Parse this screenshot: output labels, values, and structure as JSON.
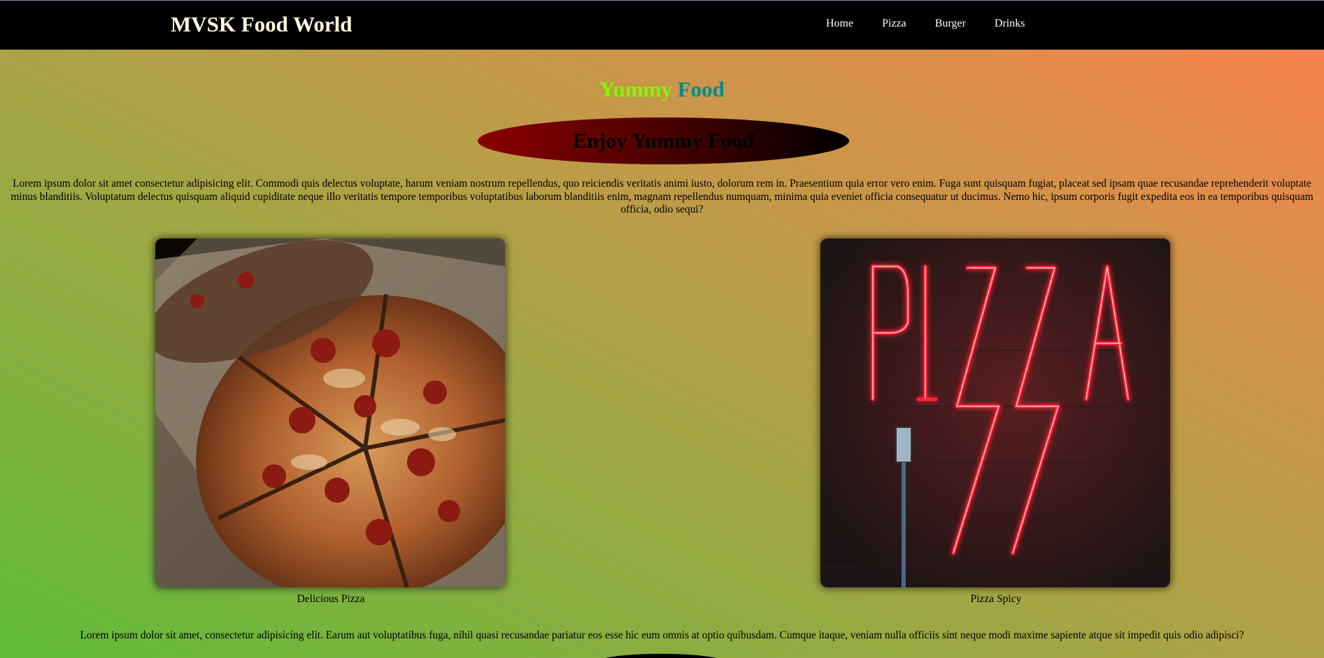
{
  "header": {
    "brand": "MVSK Food World",
    "nav": [
      {
        "label": "Home"
      },
      {
        "label": "Pizza"
      },
      {
        "label": "Burger"
      },
      {
        "label": "Drinks"
      }
    ]
  },
  "hero": {
    "title_word1": "Yummy",
    "title_word2": "Food",
    "banner": "Enjoy Yummy Food"
  },
  "intro_paragraph": "Lorem ipsum dolor sit amet consectetur adipisicing elit. Commodi quis delectus voluptate, harum veniam nostrum repellendus, quo reiciendis veritatis animi iusto, dolorum rem in. Praesentium quia error vero enim. Fuga sunt quisquam fugiat, placeat sed ipsam quae recusandae reprehenderit voluptate minus blanditiis. Voluptatum delectus quisquam aliquid cupiditate neque illo veritatis tempore temporibus voluptatibus laborum blanditiis enim, magnam repellendus numquam, minima quia eveniet officia consequatur ut ducimus. Nemo hic, ipsum corporis fugit expedita eos in ea temporibus quisquam officia, odio sequi?",
  "cards": [
    {
      "caption": "Delicious Pizza",
      "image": "pizza-photo"
    },
    {
      "caption": "Pizza Spicy",
      "image": "neon-pizza-sign-photo"
    }
  ],
  "second_paragraph": "Lorem ipsum dolor sit amet, consectetur adipisicing elit. Earum aut voluptatibus fuga, nihil quasi recusandae pariatur eos esse hic eum omnis at optio quibusdam. Cumque itaque, veniam nulla officiis sint neque modi maxime sapiente atque sit impedit quis odio adipisci?",
  "colors": {
    "navbar": "#000000",
    "brand": "#fff8dc",
    "title_word1": "#7cfc00",
    "title_word2": "#008b8b",
    "gradient_start": "#5fbb3a",
    "gradient_end": "#ff7f50"
  }
}
